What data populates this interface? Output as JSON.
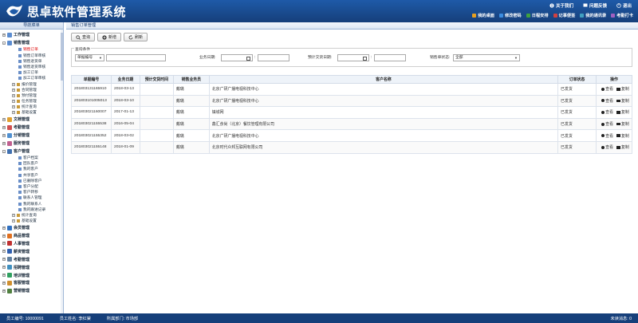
{
  "app": {
    "title": "思卓软件管理系统",
    "top_links": [
      {
        "label": "关于我们",
        "icon": "info-icon"
      },
      {
        "label": "问题反馈",
        "icon": "feedback-icon"
      },
      {
        "label": "退出",
        "icon": "exit-icon"
      }
    ],
    "quick_links": [
      {
        "label": "我的桌面",
        "color": "#e8a020"
      },
      {
        "label": "修改密码",
        "color": "#3c8de0"
      },
      {
        "label": "日程安排",
        "color": "#40a040"
      },
      {
        "label": "记事便签",
        "color": "#d04040"
      },
      {
        "label": "我的通讯录",
        "color": "#40a0c0"
      },
      {
        "label": "考勤打卡",
        "color": "#a060c0"
      }
    ]
  },
  "sidebar": {
    "title": "导航菜单",
    "menu": [
      {
        "type": "node",
        "label": "工作管理",
        "pm": "+",
        "color": "#5b8cd0"
      },
      {
        "type": "node",
        "label": "销售管理",
        "pm": "-",
        "color": "#5b8cd0"
      },
      {
        "type": "sub",
        "label": "销售订单",
        "active": true
      },
      {
        "type": "sub",
        "label": "销售订单审核"
      },
      {
        "type": "sub",
        "label": "销售退货单"
      },
      {
        "type": "sub",
        "label": "销售退货审核"
      },
      {
        "type": "sub",
        "label": "加工订单"
      },
      {
        "type": "sub",
        "label": "加工订单审核"
      },
      {
        "type": "sub2",
        "label": "报价管理",
        "pm": "+"
      },
      {
        "type": "sub2",
        "label": "合同管理",
        "pm": "+"
      },
      {
        "type": "sub2",
        "label": "预付管理",
        "pm": "+"
      },
      {
        "type": "sub2",
        "label": "任务管理",
        "pm": "+"
      },
      {
        "type": "sub2",
        "label": "统计查询",
        "pm": "+"
      },
      {
        "type": "sub2",
        "label": "基础设置",
        "pm": "+"
      },
      {
        "type": "node",
        "label": "文档管理",
        "pm": "+",
        "color": "#e0a030"
      },
      {
        "type": "node",
        "label": "考勤管理",
        "pm": "+",
        "color": "#d05050"
      },
      {
        "type": "node",
        "label": "分销管理",
        "pm": "+",
        "color": "#5090d0"
      },
      {
        "type": "node",
        "label": "服务管理",
        "pm": "+",
        "color": "#c06090"
      },
      {
        "type": "node",
        "label": "客户管理",
        "pm": "-",
        "color": "#4070b0"
      },
      {
        "type": "sub",
        "label": "客户档案"
      },
      {
        "type": "sub",
        "label": "团队客户"
      },
      {
        "type": "sub",
        "label": "我的客户"
      },
      {
        "type": "sub",
        "label": "共享客户"
      },
      {
        "type": "sub",
        "label": "已删除客户"
      },
      {
        "type": "sub",
        "label": "客户分配"
      },
      {
        "type": "sub",
        "label": "客户转移"
      },
      {
        "type": "sub",
        "label": "联系人管理"
      },
      {
        "type": "sub",
        "label": "我的联系人"
      },
      {
        "type": "sub",
        "label": "我的跟进记录"
      },
      {
        "type": "sub2",
        "label": "统计查询",
        "pm": "+"
      },
      {
        "type": "sub2",
        "label": "基础设置",
        "pm": "+"
      },
      {
        "type": "node",
        "label": "会员管理",
        "pm": "+",
        "color": "#3070c0"
      },
      {
        "type": "node",
        "label": "商品管理",
        "pm": "+",
        "color": "#e07020"
      },
      {
        "type": "node",
        "label": "人事管理",
        "pm": "+",
        "color": "#c03030"
      },
      {
        "type": "node",
        "label": "薪资管理",
        "pm": "+",
        "color": "#3060b0"
      },
      {
        "type": "node",
        "label": "考勤管理",
        "pm": "+",
        "color": "#6080a0"
      },
      {
        "type": "node",
        "label": "招聘管理",
        "pm": "+",
        "color": "#4090c0"
      },
      {
        "type": "node",
        "label": "培训管理",
        "pm": "+",
        "color": "#30a060"
      },
      {
        "type": "node",
        "label": "客服管理",
        "pm": "+",
        "color": "#d09030"
      },
      {
        "type": "node",
        "label": "营销管理",
        "pm": "+",
        "color": "#508040"
      }
    ]
  },
  "main": {
    "tab_title": "销售订单管理",
    "toolbar": [
      {
        "label": "查询",
        "icon": "search-icon"
      },
      {
        "label": "新增",
        "icon": "add-icon"
      },
      {
        "label": "刷新",
        "icon": "refresh-icon"
      }
    ],
    "query": {
      "legend": "查询条件",
      "field_select": "单据编号",
      "field_value": "",
      "date_label": "业务日期:",
      "expected_label": "预计交货日期:",
      "status_label": "销售单状态:",
      "status_value": "全部",
      "colon": ":"
    },
    "table": {
      "headers": [
        "单据编号",
        "业务日期",
        "预计交货时间",
        "销售业务员",
        "客户名称",
        "订单状态",
        "操作"
      ],
      "view_label": "查看",
      "copy_label": "复制",
      "rows": [
        [
          "201803131165910",
          "2018-03-13",
          "",
          "戴璐",
          "北京广研广播电视科技中心",
          "已发货"
        ],
        [
          "201803101005013",
          "2018-03-10",
          "",
          "戴璐",
          "北京广研广播电视科技中心",
          "已发货"
        ],
        [
          "201803021160007",
          "2017-01-13",
          "",
          "戴璐",
          "镇城网",
          "已发货"
        ],
        [
          "201803021155538",
          "2016-05-04",
          "",
          "戴璐",
          "鑫汇食尚（北京）餐饮管理有限公司",
          "已发货"
        ],
        [
          "201803021155352",
          "2018-03-02",
          "",
          "戴璐",
          "北京广研广播电视科技中心",
          "已发货"
        ],
        [
          "201803021155148",
          "2018-01-09",
          "",
          "戴璐",
          "北京时代众邦互联网有限公司",
          "已发货"
        ]
      ]
    }
  },
  "footer": {
    "employee_id": "员工编号: 10000091",
    "employee_name": "员工姓名: 李红棠",
    "department": "所属部门: 市场部",
    "unread": "未读消息: 0"
  }
}
